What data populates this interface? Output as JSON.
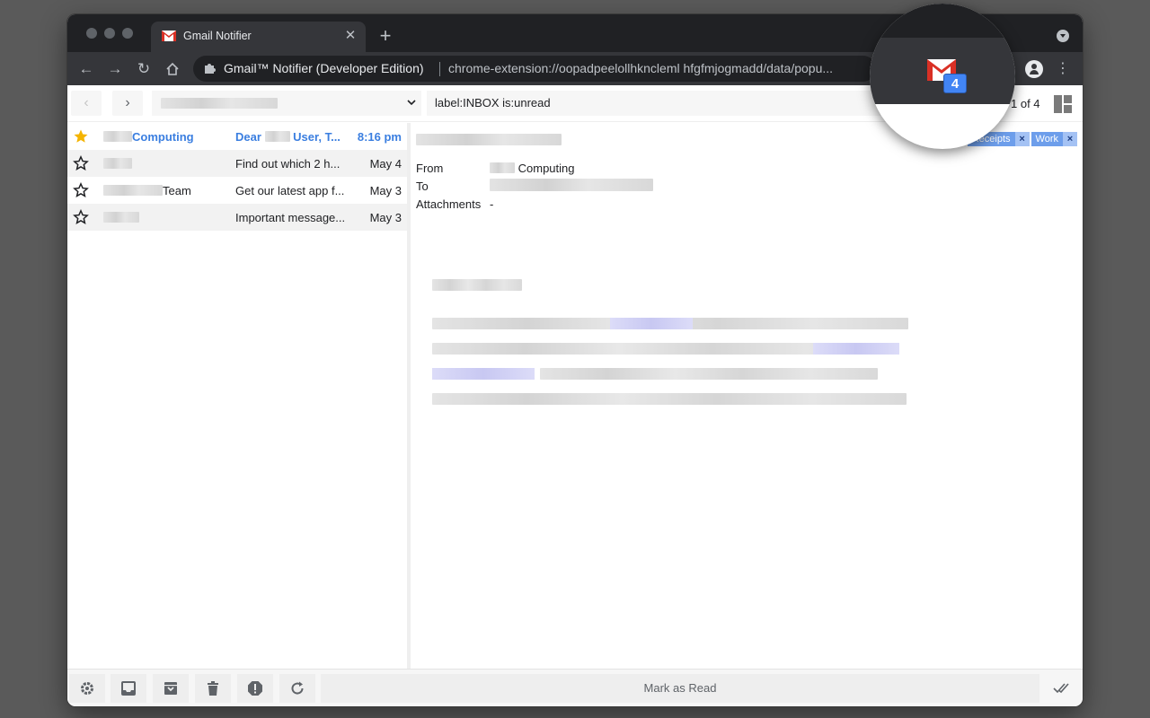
{
  "browser": {
    "tab_title": "Gmail Notifier",
    "extension_name": "Gmail™ Notifier (Developer Edition)",
    "url": "chrome-extension://oopadpeelollhkncleml hfgfmjogmadd/data/popu..."
  },
  "header": {
    "query": "label:INBOX is:unread",
    "counter": "1 of 4"
  },
  "emails": [
    {
      "sender": "Computing",
      "subject": "Dear        User, T...",
      "subject_before": "Dear",
      "subject_after": "User, T...",
      "date": "8:16 pm",
      "unread": true,
      "starred": true
    },
    {
      "sender": "",
      "subject": "Find out which 2 h...",
      "date": "May 4",
      "unread": false,
      "starred": false
    },
    {
      "sender": "Team",
      "subject": "Get our latest app f...",
      "date": "May 3",
      "unread": false,
      "starred": false
    },
    {
      "sender": "",
      "subject": "Important message...",
      "date": "May 3",
      "unread": false,
      "starred": false
    }
  ],
  "reader": {
    "labels": [
      {
        "name": "Receipts",
        "remove": "×"
      },
      {
        "name": "Work",
        "remove": "×"
      }
    ],
    "from_key": "From",
    "from_value": "Computing",
    "to_key": "To",
    "attachments_key": "Attachments",
    "attachments_value": "-"
  },
  "footer": {
    "mark_as_read": "Mark as Read"
  },
  "badge": {
    "count": "4"
  },
  "colors": {
    "unread": "#3a7ee0",
    "star": "#f4b400",
    "badge": "#4285f4"
  }
}
